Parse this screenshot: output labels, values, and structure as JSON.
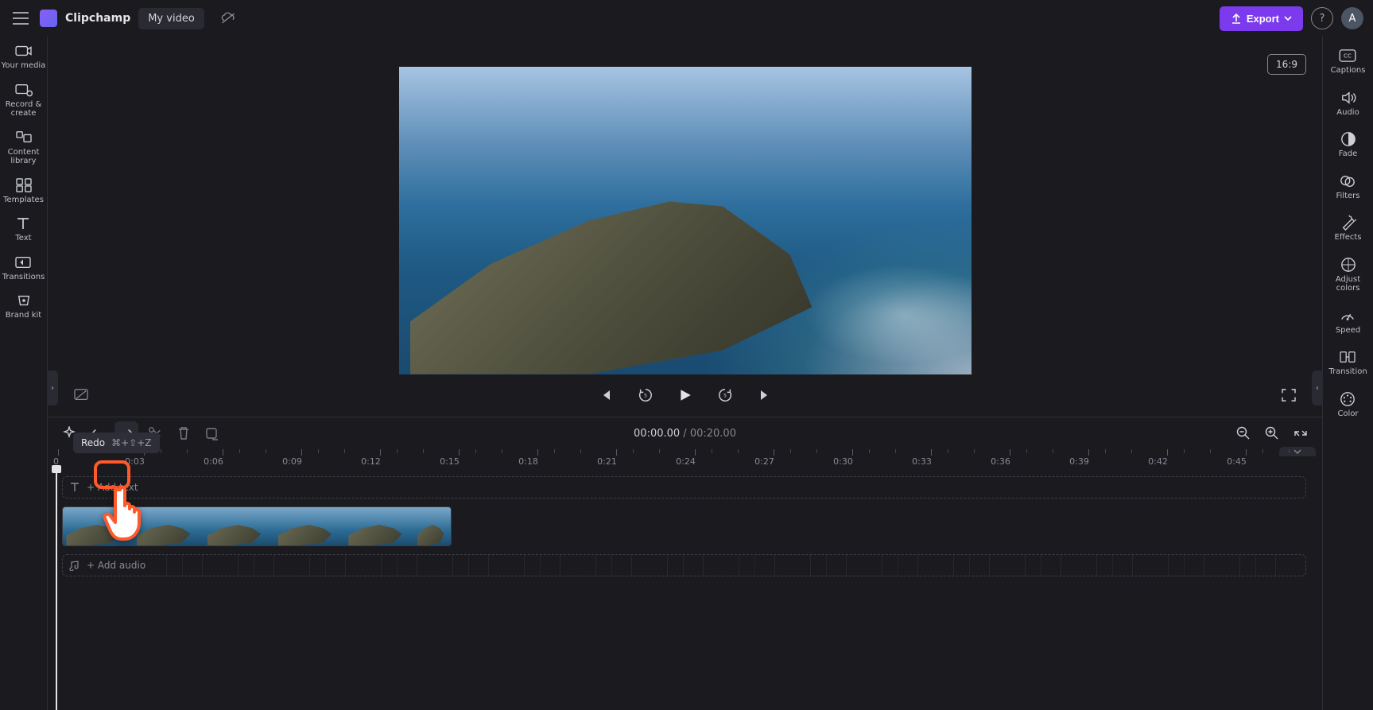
{
  "header": {
    "app_name": "Clipchamp",
    "project_name": "My video",
    "export_label": "Export",
    "avatar_initial": "A"
  },
  "aspect_ratio": "16:9",
  "left_rail": {
    "items": [
      {
        "name": "your-media",
        "label": "Your media"
      },
      {
        "name": "record-create",
        "label": "Record & create"
      },
      {
        "name": "content-library",
        "label": "Content library"
      },
      {
        "name": "templates",
        "label": "Templates"
      },
      {
        "name": "text",
        "label": "Text"
      },
      {
        "name": "transitions",
        "label": "Transitions"
      },
      {
        "name": "brand-kit",
        "label": "Brand kit"
      }
    ]
  },
  "right_rail": {
    "items": [
      {
        "name": "captions",
        "label": "Captions"
      },
      {
        "name": "audio",
        "label": "Audio"
      },
      {
        "name": "fade",
        "label": "Fade"
      },
      {
        "name": "filters",
        "label": "Filters"
      },
      {
        "name": "effects",
        "label": "Effects"
      },
      {
        "name": "adjust-colors",
        "label": "Adjust colors"
      },
      {
        "name": "speed",
        "label": "Speed"
      },
      {
        "name": "transition",
        "label": "Transition"
      },
      {
        "name": "color",
        "label": "Color"
      }
    ]
  },
  "tooltip": {
    "label": "Redo",
    "shortcut": "⌘+⇧+Z"
  },
  "timecode": {
    "current": "00:00.00",
    "total": "00:20.00",
    "separator": "/"
  },
  "ruler_labels": [
    "0",
    "0:03",
    "0:06",
    "0:09",
    "0:12",
    "0:15",
    "0:18",
    "0:21",
    "0:24",
    "0:27",
    "0:30",
    "0:33",
    "0:36",
    "0:39",
    "0:42",
    "0:45"
  ],
  "tracks": {
    "text_label": "+ Add text",
    "audio_label": "+ Add audio"
  }
}
